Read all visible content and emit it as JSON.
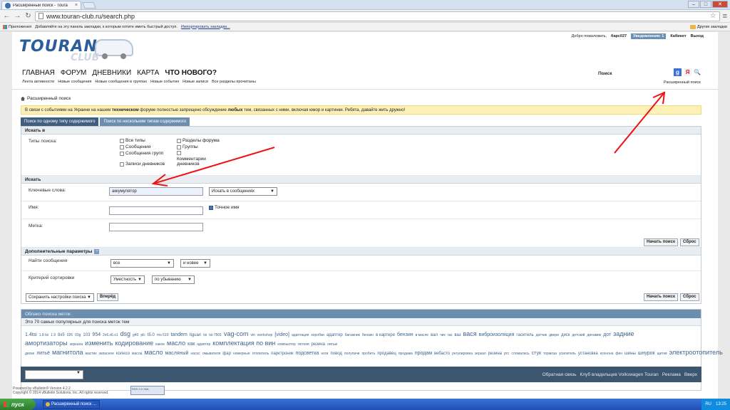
{
  "browser": {
    "tab_title": "Расширенный поиск - Toura",
    "url": "www.touran-club.ru/search.php",
    "bookmarks": {
      "apps": "Приложения",
      "hint": "Добавляйте на эту панель закладки, к которым хотите иметь быстрый доступ.",
      "import": "Импортировать закладки...",
      "other": "Другие закладки"
    }
  },
  "logo": {
    "main": "TOURAN",
    "sub": "CLUB"
  },
  "userbar": {
    "welcome": "Добро пожаловать,",
    "username": "барс027",
    "notifications": "Уведомления: 1",
    "cabinet": "Кабинет",
    "logout": "Выход"
  },
  "nav": {
    "items": [
      "ГЛАВНАЯ",
      "ФОРУМ",
      "ДНЕВНИКИ",
      "КАРТА",
      "ЧТО НОВОГО?"
    ],
    "sub": [
      "Лента активности",
      "Новые сообщения",
      "Новые сообщения в группах",
      "Новые события",
      "Новые записи",
      "Все разделы прочитаны"
    ],
    "search": "Поиск",
    "google": "g",
    "yandex": "Я",
    "advanced": "Расширенный поиск"
  },
  "breadcrumb": "Расширенный поиск",
  "notice": {
    "part1": "В связи с событиями на Украине на нашем ",
    "bold1": "техническом",
    "part2": " форуме полностью запрещено обсуждение ",
    "bold2": "любых",
    "part3": " тем, связанных с ними, включая юмор и картинки. Ребята, давайте жить дружно!"
  },
  "tabs": [
    "Поиск по одному типу содержимого",
    "Поиск по нескольким типам содержимого"
  ],
  "form": {
    "search_in": "Искать в",
    "types_label": "Типы поиска:",
    "types": [
      {
        "label": "Все типы",
        "checked": false
      },
      {
        "label": "Сообщения",
        "checked": false
      },
      {
        "label": "Сообщения групп",
        "checked": false
      },
      {
        "label": "Записи дневников",
        "checked": false
      },
      {
        "label": "Разделы форума",
        "checked": false
      },
      {
        "label": "Группы",
        "checked": false
      },
      {
        "label": "Комментарии дневников",
        "checked": false
      }
    ],
    "search": "Искать",
    "keywords_label": "Ключевые слова:",
    "keywords_value": "аккумулятор",
    "keywords_scope": "Искать в сообщениях",
    "name_label": "Имя:",
    "exact_name": "Точное имя",
    "tag_label": "Метка:",
    "start_button": "Начать поиск",
    "reset_button": "Сброс",
    "extra": "Дополнительные параметры",
    "find_posts_label": "Найти сообщения",
    "find_posts_value": "все",
    "find_posts_when": "и новее",
    "sort_label": "Критерий сортировки",
    "sort_by": "Уместность",
    "sort_order": "по убыванию",
    "save_prefs": "Сохранить настройки поиска",
    "go": "Вперёд"
  },
  "tagcloud": {
    "title": "Облако поиска меток",
    "subtitle": "Это 70 самых популярных для поиска меток тем",
    "tags": [
      "1.4tsi",
      "1.8 tsi",
      "1.9",
      "8x5",
      "026",
      "03g",
      "103",
      "954",
      "2x6.x6.s1",
      "dsg",
      "g40",
      "plc",
      "t5.0",
      "rns 510",
      "tandem",
      "tiguan",
      "tsi",
      "tsi-7501",
      "vag-com",
      "vin",
      "workshop",
      "[video]",
      "адаптация",
      "коробки",
      "адаптер",
      "багажник",
      "бензин",
      "в картере",
      "бензин",
      "в масле",
      "вал",
      "чик",
      "газ",
      "ваз",
      "вася",
      "виброизоляция",
      "гаситель",
      "датчик",
      "двери",
      "диск",
      "детский",
      "динамик",
      "дот",
      "задние амортизаторы",
      "зеркала",
      "изменить",
      "кодирование",
      "какое",
      "масло",
      "как",
      "адаптер",
      "комплектация по вин",
      "компьютер",
      "летняя",
      "резина",
      "литые диски",
      "литьё",
      "магнитола",
      "мастик",
      "запасное",
      "колесо",
      "масла",
      "масло",
      "масляный",
      "насос",
      "омывателя",
      "фар",
      "номерные",
      "отопитель",
      "парктроник",
      "подсветка",
      "ноги",
      "повод",
      "полупачи",
      "пробить",
      "продавец",
      "продажа",
      "продам",
      "вебасто",
      "регулировка",
      "зеркал",
      "резина",
      "ртс",
      "сломалась",
      "стук",
      "тормоза",
      "усилитель",
      "установка",
      "ксенона",
      "фен",
      "шины",
      "шнурок",
      "щетки",
      "электроотопитель"
    ]
  },
  "footer": {
    "links": [
      "Обратная связь",
      "Клуб владельцев Volkswagen Touran",
      "Реклама",
      "Вверх"
    ],
    "powered": "Powered by vBulletin® Version 4.2.2",
    "copyright": "Copyright © 2014 vBulletin Solutions, Inc. All rights reserved.",
    "badge": "RSS 2.0 XML"
  },
  "taskbar": {
    "start": "пуск",
    "task": "Расширенный поиск ...",
    "lang": "RU",
    "time": "13:25"
  }
}
